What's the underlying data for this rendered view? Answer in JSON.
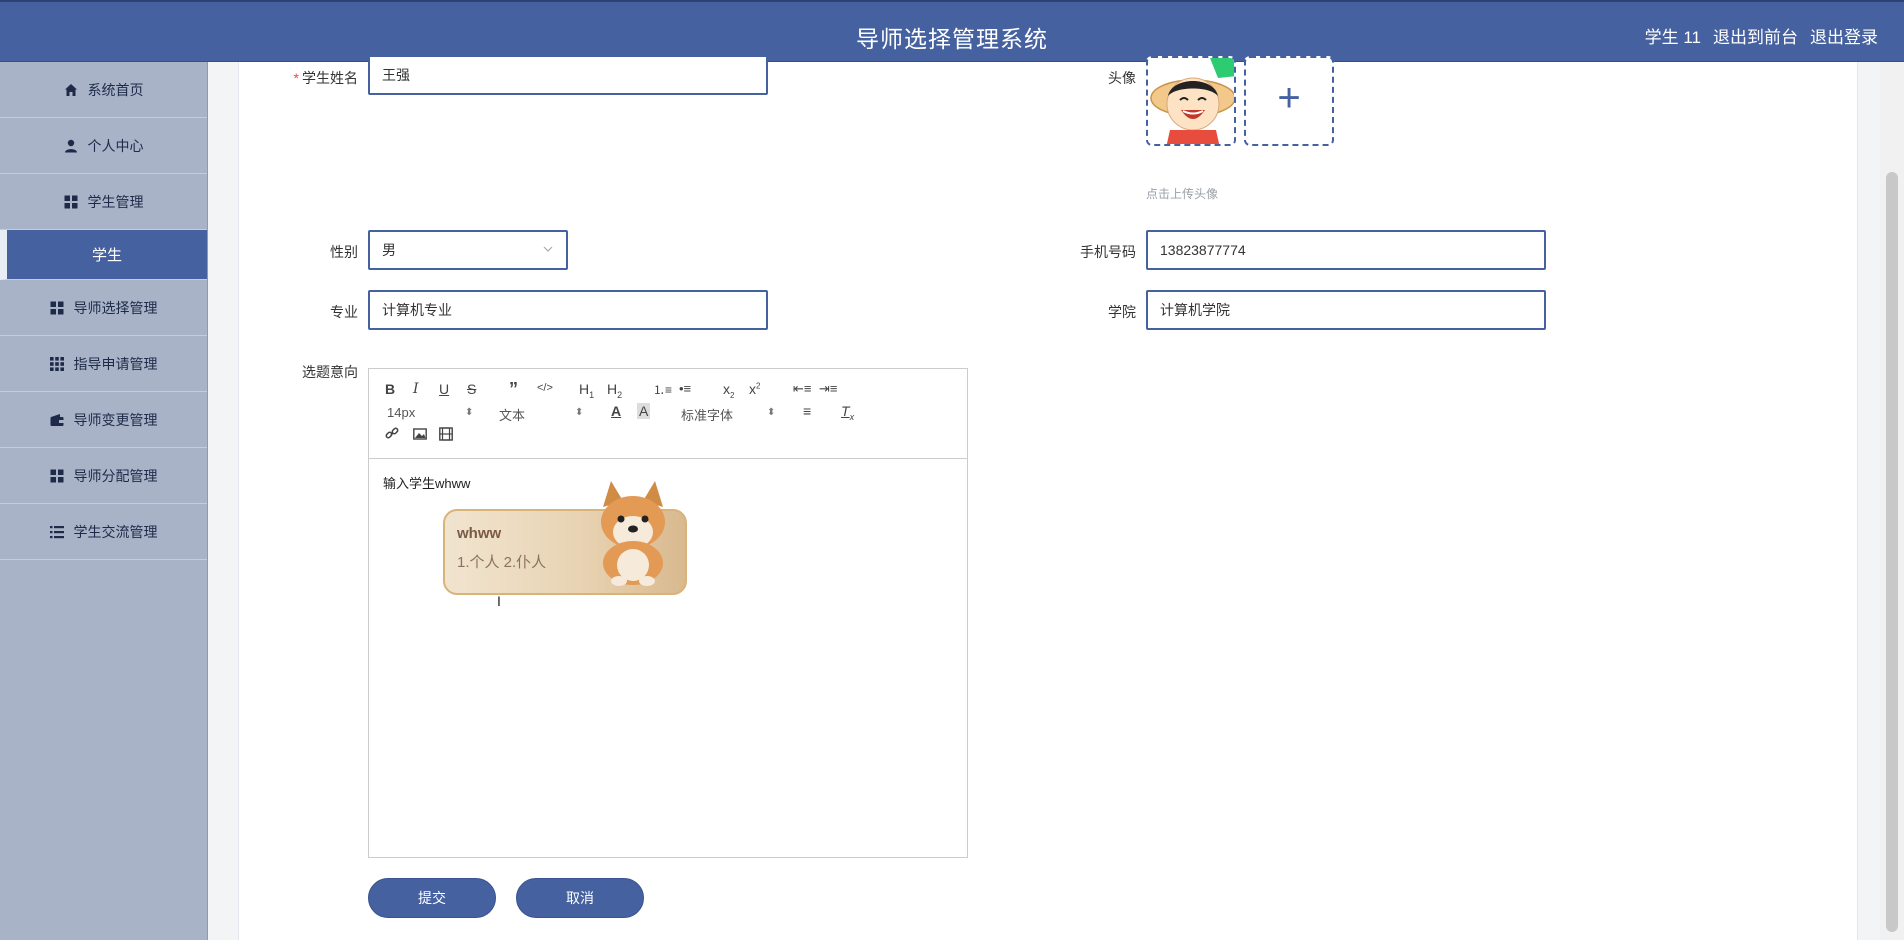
{
  "header": {
    "title": "导师选择管理系统",
    "user": "学生 11",
    "to_front": "退出到前台",
    "logout": "退出登录"
  },
  "sidebar": {
    "items": [
      {
        "label": "系统首页",
        "icon": "home-icon"
      },
      {
        "label": "个人中心",
        "icon": "user-icon"
      },
      {
        "label": "学生管理",
        "icon": "grid-icon"
      },
      {
        "label": "学生",
        "icon": ""
      },
      {
        "label": "导师选择管理",
        "icon": "grid-icon"
      },
      {
        "label": "指导申请管理",
        "icon": "apps-icon"
      },
      {
        "label": "导师变更管理",
        "icon": "wallet-icon"
      },
      {
        "label": "导师分配管理",
        "icon": "grid-icon"
      },
      {
        "label": "学生交流管理",
        "icon": "list-icon"
      }
    ]
  },
  "form": {
    "name_label": "学生姓名",
    "name_value": "王强",
    "avatar_label": "头像",
    "avatar_hint": "点击上传头像",
    "gender_label": "性别",
    "gender_value": "男",
    "phone_label": "手机号码",
    "phone_value": "13823877774",
    "major_label": "专业",
    "major_value": "计算机专业",
    "college_label": "学院",
    "college_value": "计算机学院",
    "topic_label": "选题意向"
  },
  "editor": {
    "font_size": "14px",
    "block_type": "文本",
    "font_family": "标准字体",
    "content": "输入学生whww",
    "sticker_line1": "whww",
    "sticker_line2": "1.个人  2.仆人"
  },
  "actions": {
    "submit": "提交",
    "cancel": "取消"
  },
  "colors": {
    "primary": "#4661a0",
    "sidebar": "#a8b3c8"
  }
}
